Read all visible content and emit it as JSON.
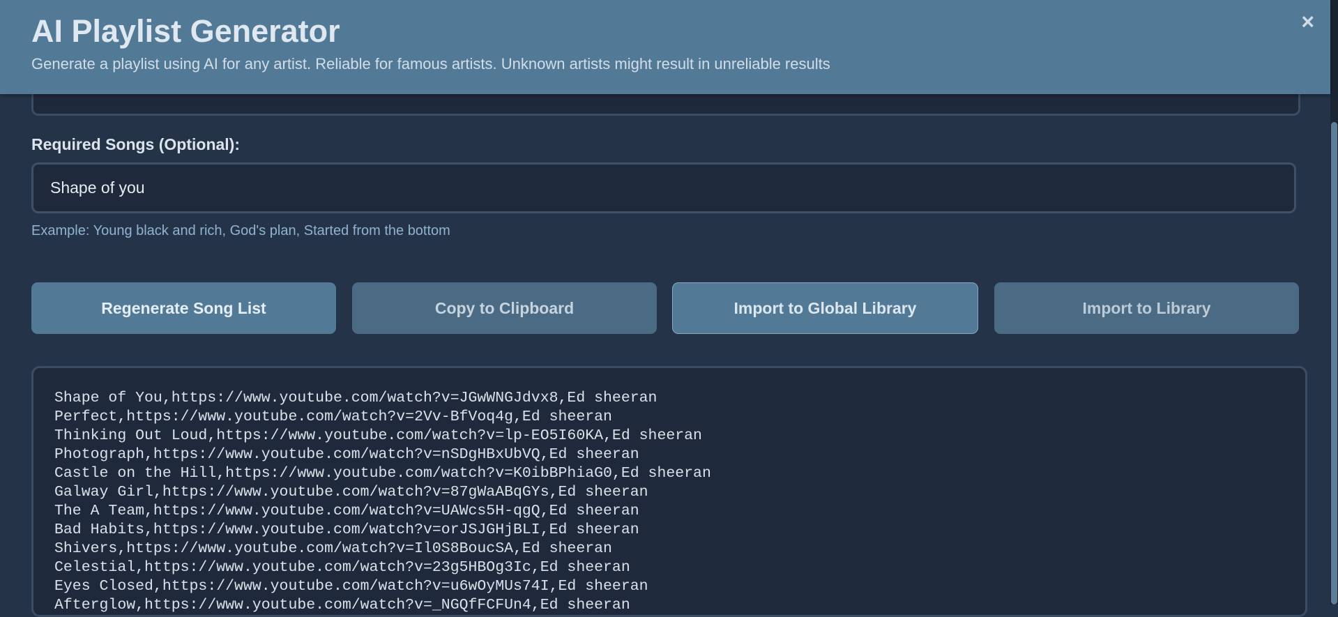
{
  "header": {
    "title": "AI Playlist Generator",
    "subtitle": "Generate a playlist using AI for any artist. Reliable for famous artists. Unknown artists might result in unreliable results",
    "close_icon": "×"
  },
  "required_songs": {
    "label": "Required Songs (Optional):",
    "value": "Shape of you",
    "help": "Example: Young black and rich, God's plan, Started from the bottom"
  },
  "buttons": {
    "regenerate": "Regenerate Song List",
    "copy": "Copy to Clipboard",
    "import_global": "Import to Global Library",
    "import_library": "Import to Library"
  },
  "output": {
    "lines": [
      "Shape of You,https://www.youtube.com/watch?v=JGwWNGJdvx8,Ed sheeran",
      "Perfect,https://www.youtube.com/watch?v=2Vv-BfVoq4g,Ed sheeran",
      "Thinking Out Loud,https://www.youtube.com/watch?v=lp-EO5I60KA,Ed sheeran",
      "Photograph,https://www.youtube.com/watch?v=nSDgHBxUbVQ,Ed sheeran",
      "Castle on the Hill,https://www.youtube.com/watch?v=K0ibBPhiaG0,Ed sheeran",
      "Galway Girl,https://www.youtube.com/watch?v=87gWaABqGYs,Ed sheeran",
      "The A Team,https://www.youtube.com/watch?v=UAWcs5H-qgQ,Ed sheeran",
      "Bad Habits,https://www.youtube.com/watch?v=orJSJGHjBLI,Ed sheeran",
      "Shivers,https://www.youtube.com/watch?v=Il0S8BoucSA,Ed sheeran",
      "Celestial,https://www.youtube.com/watch?v=23g5HBOg3Ic,Ed sheeran",
      "Eyes Closed,https://www.youtube.com/watch?v=u6wOyMUs74I,Ed sheeran",
      "Afterglow,https://www.youtube.com/watch?v=_NGQfFCFUn4,Ed sheeran"
    ]
  },
  "colors": {
    "header_bg": "#527a96",
    "page_bg": "#243348",
    "input_bg": "#1e293b",
    "help_text": "#8fb4d0"
  }
}
